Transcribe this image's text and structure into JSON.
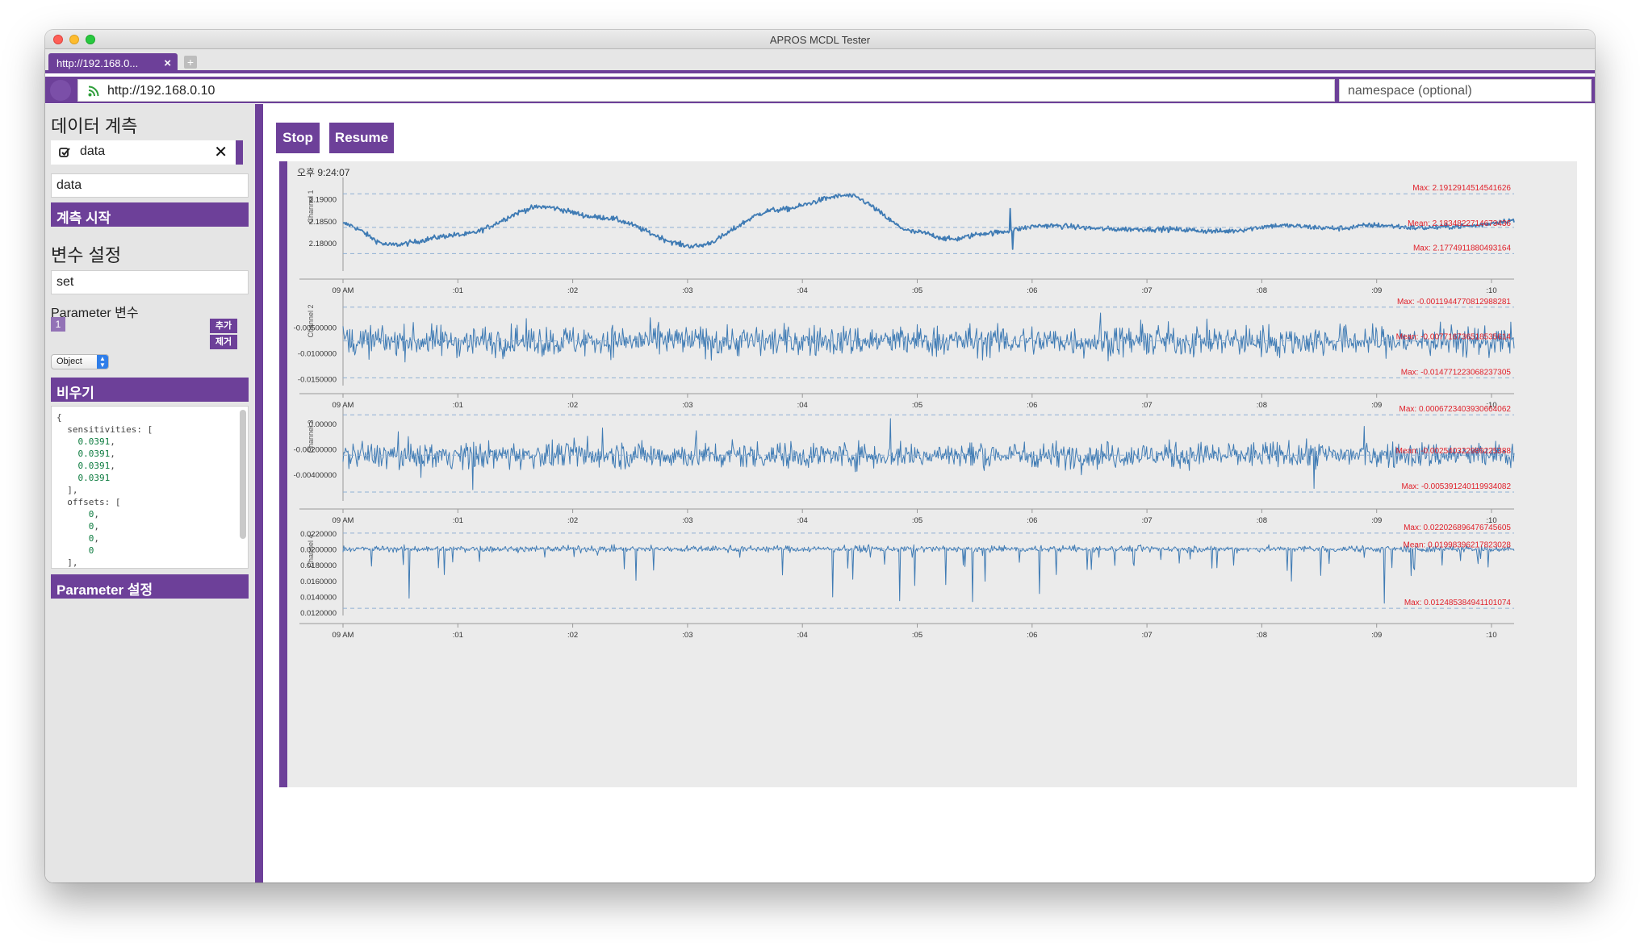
{
  "window": {
    "title": "APROS MCDL Tester"
  },
  "tabs": [
    {
      "label": "http://192.168.0..."
    }
  ],
  "address": {
    "url": "http://192.168.0.10",
    "namespace_placeholder": "namespace (optional)"
  },
  "sidebar": {
    "measure_heading": "데이터 계측",
    "data_item": "data",
    "data_input": "data",
    "start_button": "계측 시작",
    "var_heading": "변수 설정",
    "set_input": "set",
    "param_label": "Parameter 변수",
    "param_badge": "1",
    "add_button": "추가",
    "remove_button": "제거",
    "type_select": "Object",
    "clear_button": "비우기",
    "param_set_button": "Parameter 설정",
    "code_lines": [
      "{",
      "  sensitivities: [",
      "    0.0391,",
      "    0.0391,",
      "    0.0391,",
      "    0.0391",
      "  ],",
      "  offsets: [",
      "      0,",
      "      0,",
      "      0,",
      "      0",
      "  ],"
    ]
  },
  "toolbar": {
    "stop": "Stop",
    "resume": "Resume"
  },
  "chart_data": {
    "type": "line",
    "timestamp": "오후 9:24:07",
    "x_ticks": [
      "09 AM",
      ":01",
      ":02",
      ":03",
      ":04",
      ":05",
      ":06",
      ":07",
      ":08",
      ":09",
      ":10"
    ],
    "series_color": "#3f7bb4",
    "annotation_color": "#e0202a",
    "panels": [
      {
        "ylabel": "Channel 1",
        "yticks": [
          "2.19000",
          "2.18500",
          "2.18000"
        ],
        "ylim": [
          2.1735,
          2.1942
        ],
        "tick_values": [
          2.19,
          2.185,
          2.18
        ],
        "signal": "smooth",
        "noise": 0.0006,
        "keypoints": [
          [
            0,
            2.1843
          ],
          [
            0.04,
            2.1795
          ],
          [
            0.1,
            2.1818
          ],
          [
            0.17,
            2.1882
          ],
          [
            0.22,
            2.1858
          ],
          [
            0.3,
            2.1792
          ],
          [
            0.37,
            2.1875
          ],
          [
            0.43,
            2.1908
          ],
          [
            0.49,
            2.1824
          ],
          [
            0.52,
            2.1808
          ],
          [
            0.55,
            2.1822
          ],
          [
            0.6,
            2.1839
          ],
          [
            0.66,
            2.1831
          ],
          [
            0.7,
            2.1831
          ],
          [
            0.75,
            2.1826
          ],
          [
            0.8,
            2.1839
          ],
          [
            0.85,
            2.1833
          ],
          [
            0.88,
            2.184
          ],
          [
            0.92,
            2.1834
          ],
          [
            0.96,
            2.1838
          ],
          [
            1.0,
            2.1851
          ]
        ],
        "max": 2.1912,
        "mean": 2.1835,
        "min": 2.1775,
        "max_label": "Max: 2.1912914514541626",
        "mean_label": "Mean: 2.1834822714673436",
        "min_label": "Max: 2.1774911880493164"
      },
      {
        "ylabel": "Channel 2",
        "yticks": [
          "-0.00500000",
          "-0.0100000",
          "-0.0150000"
        ],
        "ylim": [
          -0.0163,
          0.0011
        ],
        "tick_values": [
          -0.005,
          -0.01,
          -0.015
        ],
        "signal": "noise",
        "base": -0.0077,
        "noise": 0.0026,
        "max": -0.0012,
        "mean": -0.0077,
        "min": -0.0148,
        "max_label": "Max: -0.0011944770812988281",
        "mean_label": "Mean: -0.007716736518535614",
        "min_label": "Max: -0.014771223068237305"
      },
      {
        "ylabel": "Channel 3",
        "yticks": [
          "0.00000",
          "-0.00200000",
          "-0.00400000"
        ],
        "ylim": [
          -0.0061,
          0.001
        ],
        "tick_values": [
          0.0,
          -0.002,
          -0.004
        ],
        "signal": "noise",
        "base": -0.0025,
        "noise": 0.0009,
        "max": 0.00067,
        "mean": -0.0025,
        "min": -0.0054,
        "max_label": "Max: 0.0006723403930664062",
        "mean_label": "Mean: -0.002540322989225388",
        "min_label": "Max: -0.005391240119934082"
      },
      {
        "ylabel": "Channel 4",
        "yticks": [
          "0.0220000",
          "0.0200000",
          "0.0180000",
          "0.0160000",
          "0.0140000",
          "0.0120000"
        ],
        "ylim": [
          0.0116,
          0.023
        ],
        "tick_values": [
          0.022,
          0.02,
          0.018,
          0.016,
          0.014,
          0.012
        ],
        "signal": "spiky",
        "base": 0.02,
        "noise": 0.0004,
        "max": 0.022,
        "mean": 0.02,
        "min": 0.0125,
        "max_label": "Max: 0.022026896476745605",
        "mean_label": "Mean: 0.01998396217823028",
        "min_label": "Max: 0.012485384941101074"
      }
    ]
  }
}
